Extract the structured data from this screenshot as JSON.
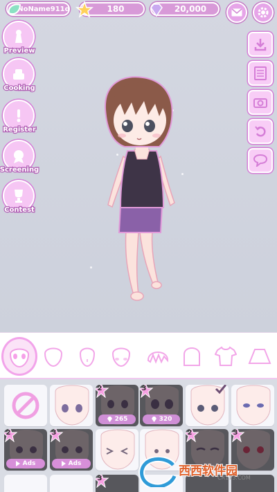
{
  "topbar": {
    "player_name": "NoName911d",
    "stars": "180",
    "gems": "20,000",
    "mail_icon": "envelope-icon",
    "settings_icon": "gear-icon"
  },
  "side_menu": [
    {
      "label": "Preview",
      "icon": "crown-dress-icon"
    },
    {
      "label": "Cooking",
      "icon": "cake-icon"
    },
    {
      "label": "Register",
      "icon": "exclamation-icon"
    },
    {
      "label": "Screening",
      "icon": "badge-icon"
    },
    {
      "label": "Contest",
      "icon": "trophy-icon"
    }
  ],
  "right_menu": [
    "download-icon",
    "list-icon",
    "camera-icon",
    "undo-icon",
    "chat-bubble-icon"
  ],
  "categories": [
    "face-icon",
    "head-shape-icon",
    "ear-face-icon",
    "face-blush-icon",
    "hair-bangs-icon",
    "hair-back-icon",
    "shirt-icon",
    "skirt-icon"
  ],
  "items_row1": [
    {
      "type": "none"
    },
    {
      "type": "free"
    },
    {
      "type": "locked",
      "level": "2",
      "price": "265"
    },
    {
      "type": "locked",
      "level": "3",
      "price": "320"
    },
    {
      "type": "free",
      "checked": true
    },
    {
      "type": "free"
    }
  ],
  "items_row2": [
    {
      "type": "locked",
      "level": "2",
      "cta": "Ads"
    },
    {
      "type": "locked",
      "level": "3",
      "cta": "Ads"
    },
    {
      "type": "free"
    },
    {
      "type": "free"
    },
    {
      "type": "locked",
      "level": "2"
    },
    {
      "type": "locked",
      "level": "3"
    }
  ],
  "items_row3": [
    {
      "type": "free"
    },
    {
      "type": "free"
    },
    {
      "type": "locked",
      "level": "3"
    },
    {
      "type": "free"
    },
    {
      "type": "locked"
    },
    {
      "type": "locked"
    }
  ],
  "watermark": {
    "brand": "西西软件园",
    "url": "CR173.COM"
  },
  "colors": {
    "accent": "#d89ad8",
    "stage": "#cfd3de",
    "item_bg": "#d9dce4"
  }
}
